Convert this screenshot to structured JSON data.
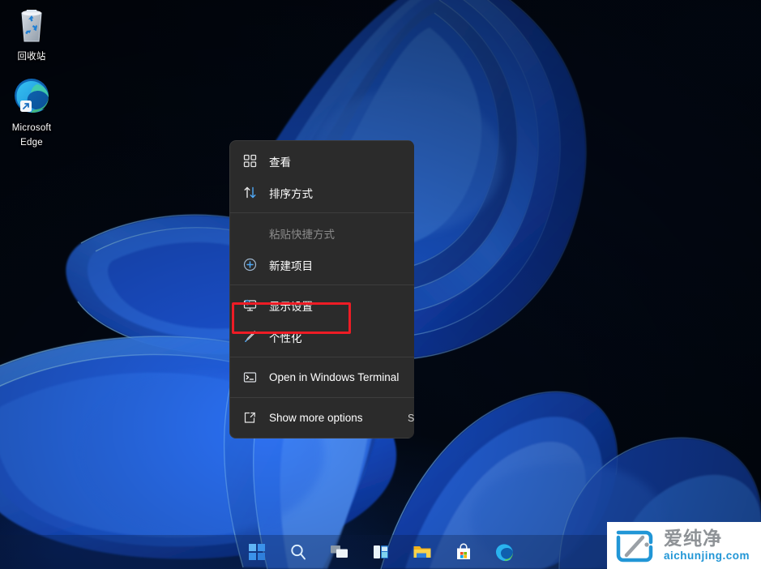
{
  "desktop": {
    "icons": [
      {
        "name": "recycle-bin",
        "label": "回收站",
        "icon": "recycle-bin-icon"
      },
      {
        "name": "microsoft-edge",
        "label": "Microsoft\nEdge",
        "label_line1": "Microsoft",
        "label_line2": "Edge",
        "icon": "edge-icon"
      }
    ]
  },
  "context_menu": {
    "background": "#2b2b2b",
    "items": [
      {
        "id": "view",
        "label": "查看",
        "icon": "grid-view-icon",
        "accel": "",
        "disabled": false,
        "highlighted": false
      },
      {
        "id": "sort-by",
        "label": "排序方式",
        "icon": "sort-arrows-icon",
        "accel": "",
        "disabled": false,
        "highlighted": false
      },
      {
        "id": "sep-1",
        "separator": true
      },
      {
        "id": "paste-shortcut",
        "label": "粘贴快捷方式",
        "icon": "",
        "accel": "",
        "disabled": true,
        "highlighted": false
      },
      {
        "id": "new-item",
        "label": "新建项目",
        "icon": "plus-circle-icon",
        "accel": "",
        "disabled": false,
        "highlighted": false
      },
      {
        "id": "sep-2",
        "separator": true
      },
      {
        "id": "display-settings",
        "label": "显示设置",
        "icon": "monitor-gear-icon",
        "accel": "",
        "disabled": false,
        "highlighted": false
      },
      {
        "id": "personalize",
        "label": "个性化",
        "icon": "paintbrush-icon",
        "accel": "",
        "disabled": false,
        "highlighted": true
      },
      {
        "id": "sep-3",
        "separator": true
      },
      {
        "id": "windows-terminal",
        "label": "Open in Windows Terminal",
        "icon": "terminal-icon",
        "accel": "",
        "disabled": false,
        "highlighted": false
      },
      {
        "id": "sep-4",
        "separator": true
      },
      {
        "id": "show-more",
        "label": "Show more options",
        "icon": "more-options-icon",
        "accel": "Shift",
        "disabled": false,
        "highlighted": false
      }
    ],
    "highlight_color": "#ee1c25"
  },
  "taskbar": {
    "buttons": [
      {
        "id": "start",
        "name": "start-button",
        "icon": "windows-logo-icon"
      },
      {
        "id": "search",
        "name": "search-button",
        "icon": "search-icon"
      },
      {
        "id": "task-view",
        "name": "task-view-button",
        "icon": "task-view-icon"
      },
      {
        "id": "widgets",
        "name": "widgets-button",
        "icon": "widgets-icon"
      },
      {
        "id": "file-explorer",
        "name": "file-explorer-button",
        "icon": "folder-icon"
      },
      {
        "id": "microsoft-store",
        "name": "microsoft-store-button",
        "icon": "store-bag-icon"
      },
      {
        "id": "edge",
        "name": "edge-taskbar-button",
        "icon": "edge-icon"
      }
    ]
  },
  "watermark": {
    "cn": "爱纯净",
    "en": "aichunjing.com",
    "logo": "aichunjing-logo-icon",
    "accent": "#2196d6"
  }
}
